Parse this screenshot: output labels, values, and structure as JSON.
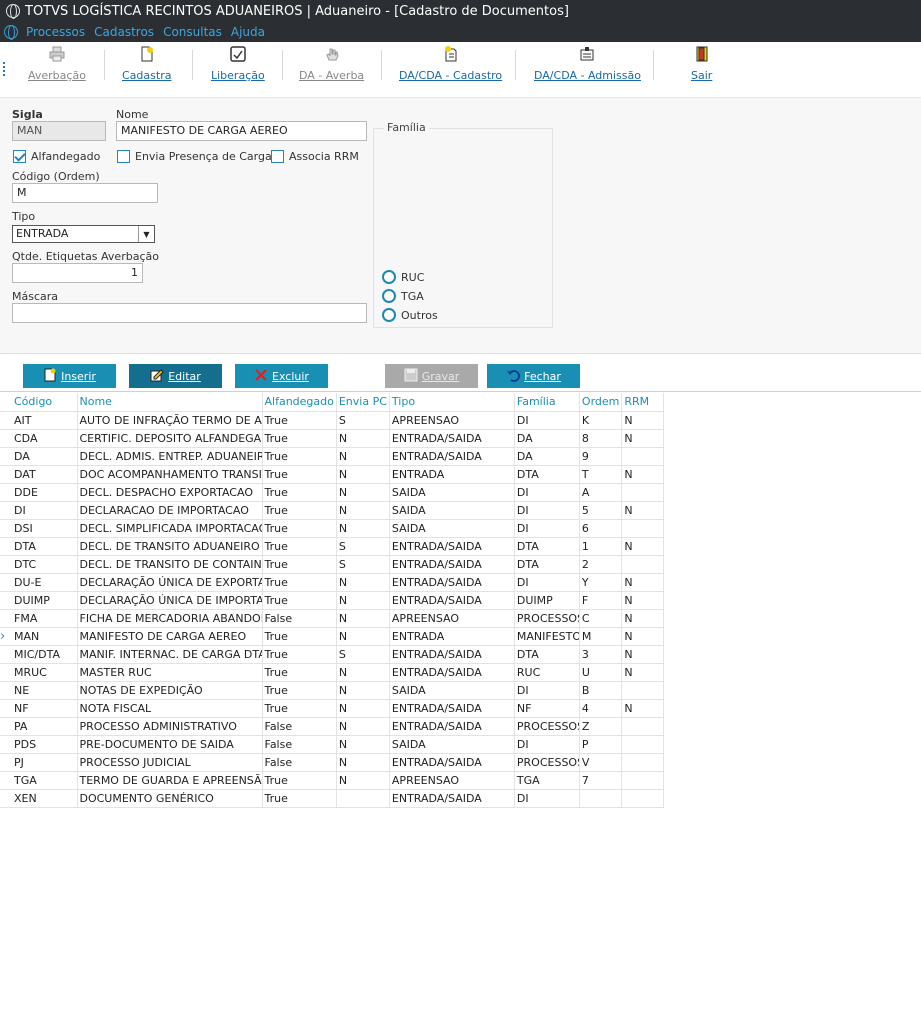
{
  "window": {
    "title": "TOTVS LOGÍSTICA RECINTOS ADUANEIROS | Aduaneiro - [Cadastro de Documentos]"
  },
  "menu": {
    "items": [
      "Processos",
      "Cadastros",
      "Consultas",
      "Ajuda"
    ]
  },
  "toolbar": {
    "averbacao": "Averbação",
    "cadastra": "Cadastra",
    "liberacao": "Liberação",
    "da_averba": "DA - Averba",
    "dacda_cadastro": "DA/CDA - Cadastro",
    "dacda_admissao": "DA/CDA - Admissão",
    "sair": "Sair"
  },
  "form": {
    "sigla_label": "Sigla",
    "sigla_value": "MAN",
    "nome_label": "Nome",
    "nome_value": "MANIFESTO DE CARGA AEREO",
    "alfandegado_label": "Alfandegado",
    "alfandegado_checked": true,
    "envia_label": "Envia Presença de Carga",
    "envia_checked": false,
    "associa_label": "Associa RRM",
    "associa_checked": false,
    "codigo_label": "Código (Ordem)",
    "codigo_value": "M",
    "tipo_label": "Tipo",
    "tipo_value": "ENTRADA",
    "qtde_label": "Qtde. Etiquetas Averbação",
    "qtde_value": "1",
    "mascara_label": "Máscara",
    "mascara_value": "",
    "familia_label": "Família",
    "familia_options": [
      "RUC",
      "TGA",
      "Outros"
    ]
  },
  "actions": {
    "inserir": "Inserir",
    "editar": "Editar",
    "excluir": "Excluir",
    "gravar": "Gravar",
    "fechar": "Fechar"
  },
  "table": {
    "columns": [
      "Código",
      "Nome",
      "Alfandegado",
      "Envia PC",
      "Tipo",
      "Família",
      "Ordem",
      "RRM"
    ],
    "selected_row": 12,
    "rows": [
      [
        "AIT",
        "AUTO DE INFRAÇÃO TERMO DE APREENSÃO",
        "True",
        "S",
        "APREENSAO",
        "DI",
        "K",
        "N"
      ],
      [
        "CDA",
        "CERTIFIC. DEPOSITO ALFANDEGADO",
        "True",
        "N",
        "ENTRADA/SAIDA",
        "DA",
        "8",
        "N"
      ],
      [
        "DA",
        "DECL. ADMIS. ENTREP. ADUANEIRO",
        "True",
        "N",
        "ENTRADA/SAIDA",
        "DA",
        "9",
        ""
      ],
      [
        "DAT",
        "DOC ACOMPANHAMENTO TRANSITO",
        "True",
        "N",
        "ENTRADA",
        "DTA",
        "T",
        "N"
      ],
      [
        "DDE",
        "DECL. DESPACHO EXPORTACAO",
        "True",
        "N",
        "SAIDA",
        "DI",
        "A",
        ""
      ],
      [
        "DI",
        "DECLARACAO DE IMPORTACAO",
        "True",
        "N",
        "SAIDA",
        "DI",
        "5",
        "N"
      ],
      [
        "DSI",
        "DECL. SIMPLIFICADA IMPORTACAO",
        "True",
        "N",
        "SAIDA",
        "DI",
        "6",
        ""
      ],
      [
        "DTA",
        "DECL. DE TRANSITO ADUANEIRO",
        "True",
        "S",
        "ENTRADA/SAIDA",
        "DTA",
        "1",
        "N"
      ],
      [
        "DTC",
        "DECL. DE TRANSITO DE CONTAINER",
        "True",
        "S",
        "ENTRADA/SAIDA",
        "DTA",
        "2",
        ""
      ],
      [
        "DU-E",
        "DECLARAÇÃO ÚNICA DE EXPORTAÇÃO",
        "True",
        "N",
        "ENTRADA/SAIDA",
        "DI",
        "Y",
        "N"
      ],
      [
        "DUIMP",
        "DECLARAÇÃO ÚNICA DE IMPORTAÇÃO",
        "True",
        "N",
        "ENTRADA/SAIDA",
        "DUIMP",
        "F",
        "N"
      ],
      [
        "FMA",
        "FICHA DE MERCADORIA ABANDONADA",
        "False",
        "N",
        "APREENSAO",
        "PROCESSOS",
        "C",
        "N"
      ],
      [
        "MAN",
        "MANIFESTO DE CARGA AEREO",
        "True",
        "N",
        "ENTRADA",
        "MANIFESTO",
        "M",
        "N"
      ],
      [
        "MIC/DTA",
        "MANIF. INTERNAC. DE CARGA DTA",
        "True",
        "S",
        "ENTRADA/SAIDA",
        "DTA",
        "3",
        "N"
      ],
      [
        "MRUC",
        "MASTER RUC",
        "True",
        "N",
        "ENTRADA/SAIDA",
        "RUC",
        "U",
        "N"
      ],
      [
        "NE",
        "NOTAS DE EXPEDIÇÃO",
        "True",
        "N",
        "SAIDA",
        "DI",
        "B",
        ""
      ],
      [
        "NF",
        "NOTA FISCAL",
        "True",
        "N",
        "ENTRADA/SAIDA",
        "NF",
        "4",
        "N"
      ],
      [
        "PA",
        "PROCESSO ADMINISTRATIVO",
        "False",
        "N",
        "ENTRADA/SAIDA",
        "PROCESSOS",
        "Z",
        ""
      ],
      [
        "PDS",
        "PRE-DOCUMENTO DE SAIDA",
        "False",
        "N",
        "SAIDA",
        "DI",
        "P",
        ""
      ],
      [
        "PJ",
        "PROCESSO JUDICIAL",
        "False",
        "N",
        "ENTRADA/SAIDA",
        "PROCESSOS",
        "V",
        ""
      ],
      [
        "TGA",
        "TERMO DE GUARDA E APREENSÃO",
        "True",
        "N",
        "APREENSAO",
        "TGA",
        "7",
        ""
      ],
      [
        "XEN",
        "DOCUMENTO GENÉRICO",
        "True",
        "",
        "ENTRADA/SAIDA",
        "DI",
        "",
        ""
      ]
    ]
  }
}
